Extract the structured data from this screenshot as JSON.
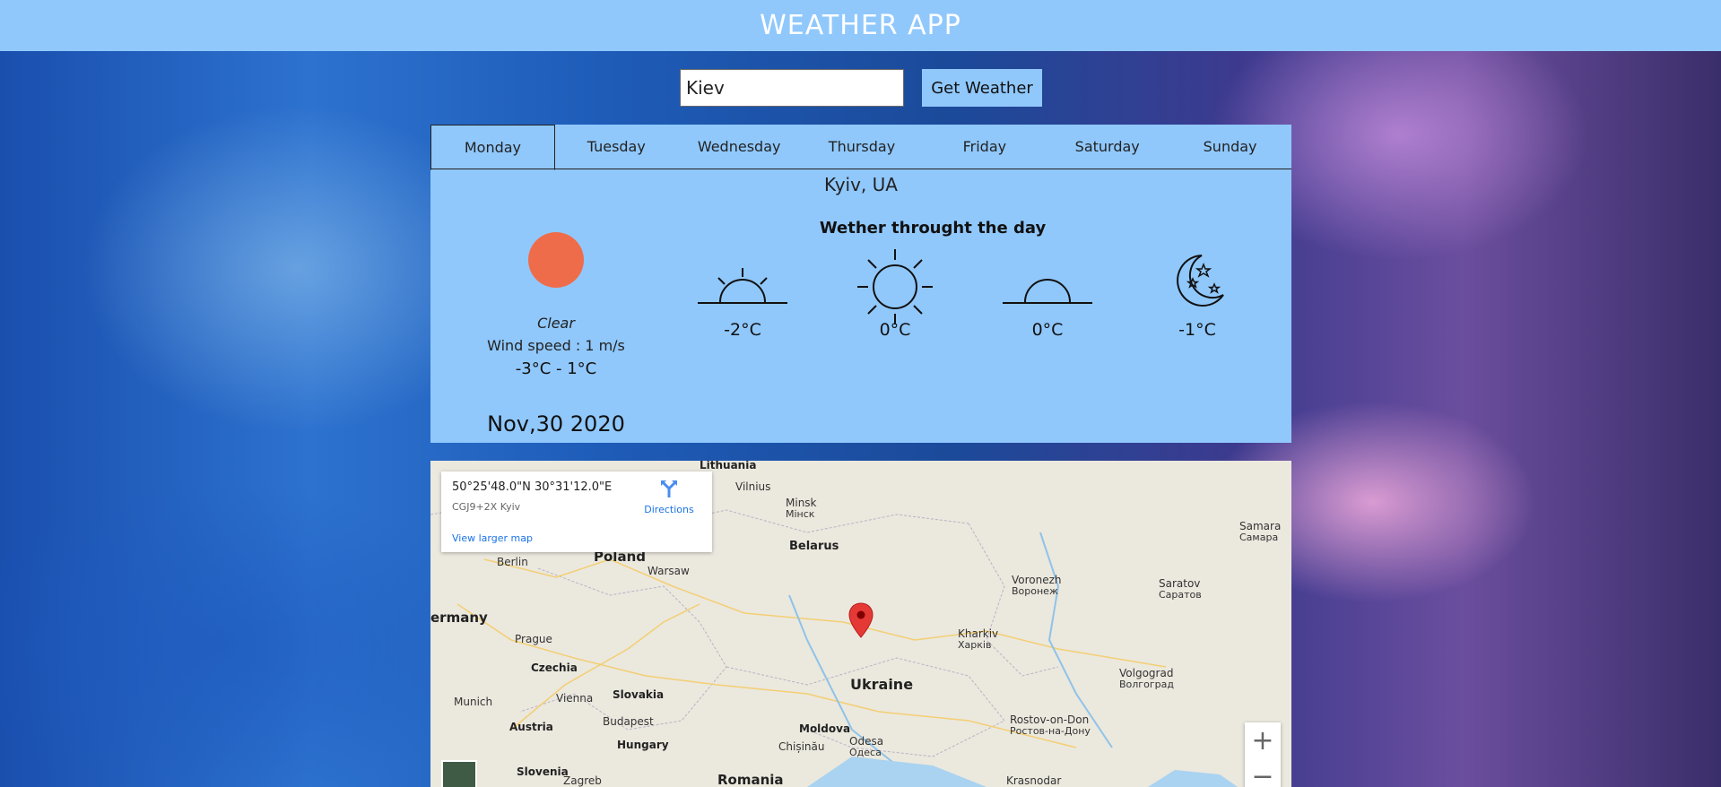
{
  "app": {
    "title": "WEATHER APP"
  },
  "search": {
    "value": "Kiev",
    "button_label": "Get Weather"
  },
  "tabs": [
    {
      "label": "Monday",
      "active": true
    },
    {
      "label": "Tuesday",
      "active": false
    },
    {
      "label": "Wednesday",
      "active": false
    },
    {
      "label": "Thursday",
      "active": false
    },
    {
      "label": "Friday",
      "active": false
    },
    {
      "label": "Saturday",
      "active": false
    },
    {
      "label": "Sunday",
      "active": false
    }
  ],
  "forecast": {
    "city": "Kyiv, UA",
    "condition": "Clear",
    "wind": "Wind speed : 1 m/s",
    "range": "-3°C - 1°C",
    "date": "Nov,30 2020",
    "dayparts_title": "Wether throught the day",
    "dayparts": [
      {
        "icon": "sunrise-icon",
        "temp": "-2°C"
      },
      {
        "icon": "sun-icon",
        "temp": "0°C"
      },
      {
        "icon": "sunset-icon",
        "temp": "0°C"
      },
      {
        "icon": "moon-stars-icon",
        "temp": "-1°C"
      }
    ]
  },
  "map": {
    "coords": "50°25'48.0\"N 30°31'12.0\"E",
    "plus_code": "CGJ9+2X Kyiv",
    "directions_label": "Directions",
    "larger_map_label": "View larger map",
    "zoom_in": "+",
    "zoom_out": "−",
    "labels": {
      "lithuania": "Lithuania",
      "vilnius": "Vilnius",
      "minsk": "Minsk",
      "minsk_cyr": "Мінск",
      "belarus": "Belarus",
      "samara": "Samara",
      "samara_cyr": "Самара",
      "poland": "Poland",
      "berlin": "Berlin",
      "warsaw": "Warsaw",
      "voronezh": "Voronezh",
      "voronezh_cyr": "Воронеж",
      "saratov": "Saratov",
      "saratov_cyr": "Саратов",
      "germany": "ermany",
      "prague": "Prague",
      "kharkiv": "Kharkiv",
      "kharkiv_cyr": "Харків",
      "czechia": "Czechia",
      "volgograd": "Volgograd",
      "volgograd_cyr": "Волгоград",
      "ukraine": "Ukraine",
      "munich": "Munich",
      "vienna": "Vienna",
      "slovakia": "Slovakia",
      "austria": "Austria",
      "budapest": "Budapest",
      "moldova": "Moldova",
      "rostov": "Rostov-on-Don",
      "rostov_cyr": "Ростов-на-Дону",
      "hungary": "Hungary",
      "chisinau": "Chișinău",
      "odesa": "Odesa",
      "odesa_cyr": "Одеса",
      "slovenia": "Slovenia",
      "zagreb": "Zagreb",
      "romania": "Romania",
      "krasnodar": "Krasnodar"
    }
  },
  "colors": {
    "header": "#90c8fc",
    "panel": "#90c8fc",
    "sun": "#ef6c4a",
    "pin": "#e53935",
    "link": "#1a73e8"
  }
}
